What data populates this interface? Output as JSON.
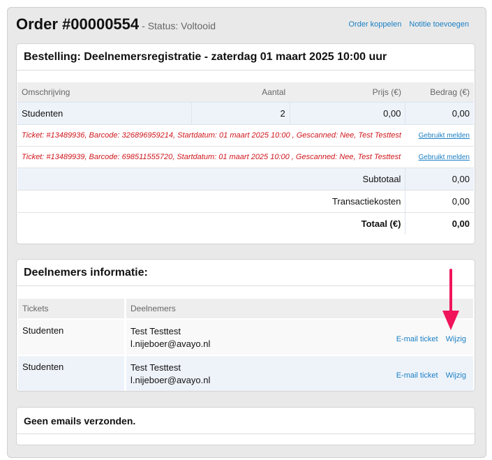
{
  "header": {
    "order_title": "Order #00000554",
    "status_text": "- Status: Voltooid",
    "link_couple": "Order koppelen",
    "link_add_note": "Notitie toevoegen"
  },
  "order": {
    "title": "Bestelling: Deelnemersregistratie - zaterdag 01 maart 2025 10:00 uur",
    "columns": [
      "Omschrijving",
      "Aantal",
      "Prijs (€)",
      "Bedrag (€)"
    ],
    "line": {
      "description": "Studenten",
      "quantity": "2",
      "price": "0,00",
      "amount": "0,00"
    },
    "tickets": [
      {
        "text": "Ticket: #13489936, Barcode: 326896959214, Startdatum: 01 maart 2025 10:00 , Gescanned: Nee, Test Testtest",
        "action": "Gebruikt melden"
      },
      {
        "text": "Ticket: #13489939, Barcode: 698511555720, Startdatum: 01 maart 2025 10:00 , Gescanned: Nee, Test Testtest",
        "action": "Gebruikt melden"
      }
    ],
    "subtotal_label": "Subtotaal",
    "subtotal_value": "0,00",
    "fees_label": "Transactiekosten",
    "fees_value": "0,00",
    "total_label": "Totaal (€)",
    "total_value": "0,00"
  },
  "participants": {
    "title": "Deelnemers informatie:",
    "columns": [
      "Tickets",
      "Deelnemers"
    ],
    "rows": [
      {
        "ticket": "Studenten",
        "name": "Test Testtest",
        "email": "l.nijeboer@avayo.nl",
        "email_action": "E-mail ticket",
        "edit_action": "Wijzig"
      },
      {
        "ticket": "Studenten",
        "name": "Test Testtest",
        "email": "l.nijeboer@avayo.nl",
        "email_action": "E-mail ticket",
        "edit_action": "Wijzig"
      }
    ]
  },
  "emails": {
    "title": "Geen emails verzonden."
  },
  "colors": {
    "accent_link": "#1a7fc4",
    "ticket_text": "#d0171d",
    "annotation_arrow": "#f0145a"
  }
}
